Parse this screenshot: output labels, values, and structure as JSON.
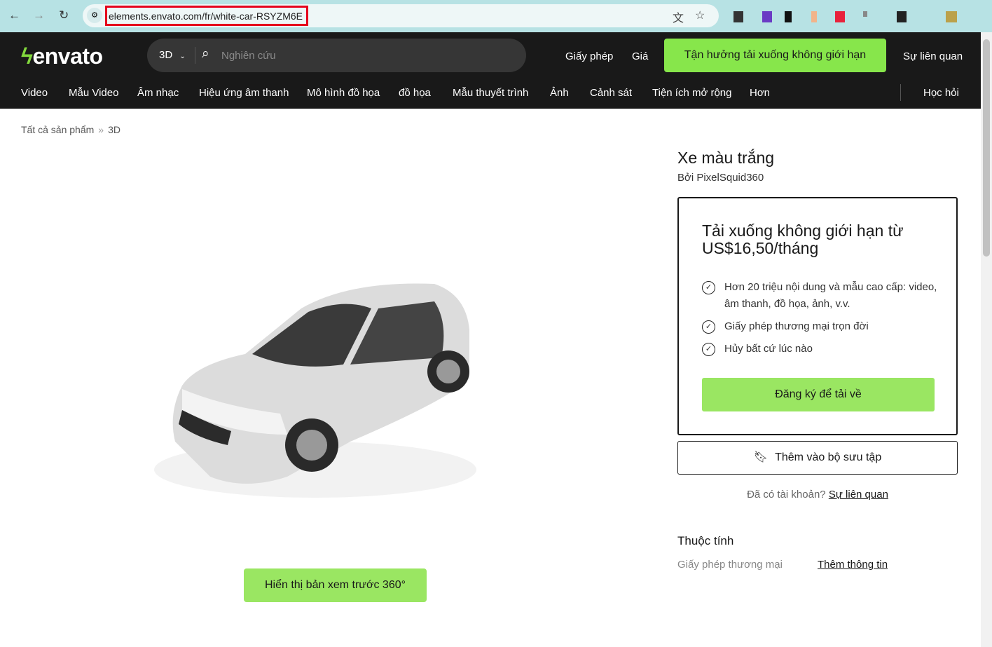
{
  "browser": {
    "url": "elements.envato.com/fr/white-car-RSYZM6E"
  },
  "header": {
    "logo": "envato",
    "search": {
      "category": "3D",
      "placeholder": "Nghiên cứu"
    },
    "links": [
      "Giấy phép",
      "Giá"
    ],
    "cta": "Tận hưởng tải xuống không giới hạn",
    "related": "Sự liên quan",
    "categories": [
      "Video",
      "Mẫu Video",
      "Âm nhạc",
      "Hiệu ứng âm thanh",
      "Mô hình đồ họa",
      "đồ họa",
      "Mẫu thuyết trình",
      "Ảnh",
      "Cảnh sát",
      "Tiện ích mở rộng",
      "Hơn"
    ],
    "learn": "Học hỏi"
  },
  "breadcrumb": [
    "Tất cả sản phẩm",
    "3D"
  ],
  "preview_button": "Hiển thị bản xem trước 360°",
  "product": {
    "title": "Xe màu trắng",
    "author": "Bởi PixelSquid360",
    "box": {
      "heading": "Tải xuống không giới hạn từ US$16,50/tháng",
      "features": [
        "Hơn 20 triệu nội dung và mẫu cao cấp: video, âm thanh, đồ họa, ảnh, v.v.",
        "Giấy phép thương mại trọn đời",
        "Hủy bất cứ lúc nào"
      ],
      "signup": "Đăng ký để tải về"
    },
    "collection": "Thêm vào bộ sưu tập",
    "account_q": "Đã có tài khoản?",
    "account_link": "Sự liên quan",
    "attributes_title": "Thuộc tính",
    "license": "Giấy phép thương mại",
    "more_info": "Thêm thông tin"
  },
  "colors": {
    "accent": "#87e64b",
    "header": "#191919"
  }
}
